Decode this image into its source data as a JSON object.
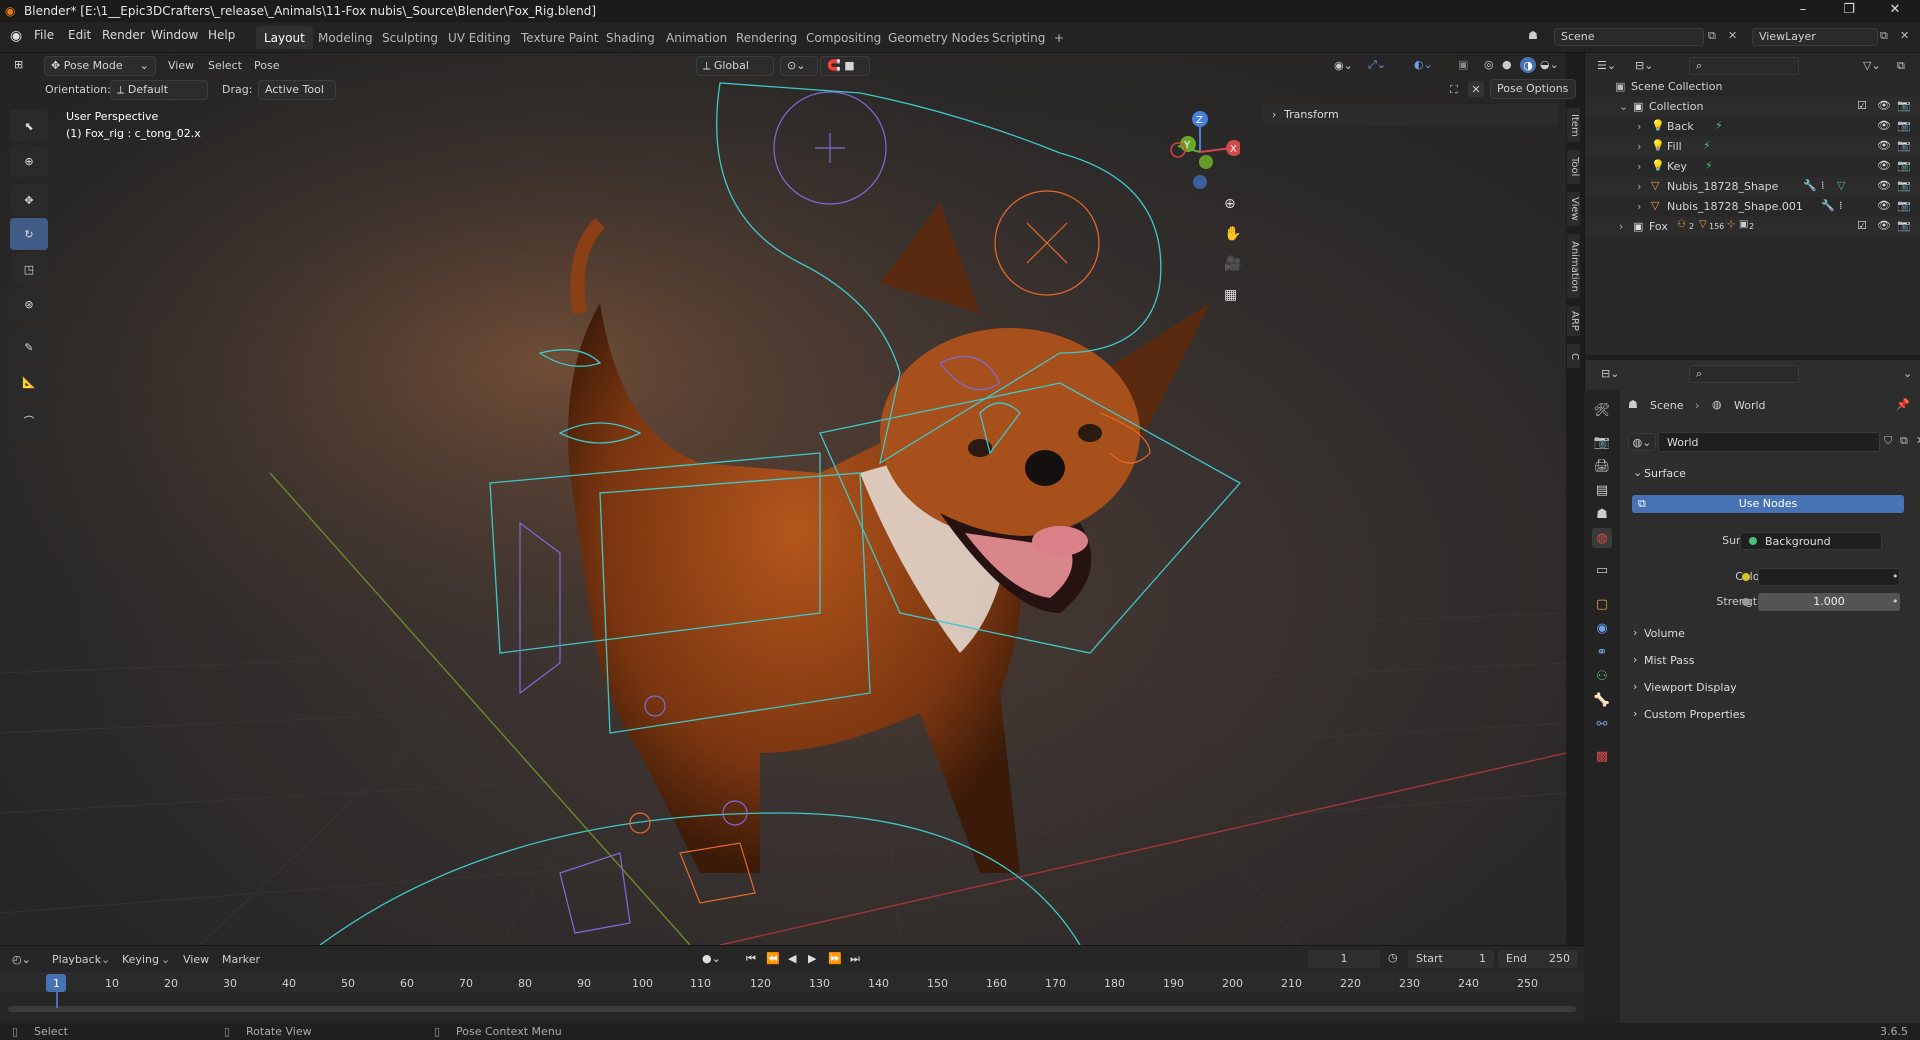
{
  "window": {
    "title": "Blender* [E:\\1__Epic3DCrafters\\_release\\_Animals\\11-Fox nubis\\_Source\\Blender\\Fox_Rig.blend]"
  },
  "menu": [
    "File",
    "Edit",
    "Render",
    "Window",
    "Help"
  ],
  "workspaces": [
    "Layout",
    "Modeling",
    "Sculpting",
    "UV Editing",
    "Texture Paint",
    "Shading",
    "Animation",
    "Rendering",
    "Compositing",
    "Geometry Nodes",
    "Scripting"
  ],
  "active_workspace": "Layout",
  "scene_field": "Scene",
  "viewlayer_field": "ViewLayer",
  "viewport": {
    "mode": "Pose Mode",
    "menus": [
      "View",
      "Select",
      "Pose"
    ],
    "transform_space": "Global",
    "orientation_label": "Orientation:",
    "orientation_value": "Default",
    "drag_label": "Drag:",
    "drag_value": "Active Tool",
    "pose_options": "Pose Options",
    "overlay_line1": "User Perspective",
    "overlay_line2": "(1) Fox_rig : c_tong_02.x",
    "npanel_section": "Transform",
    "npanel_tabs": [
      "Item",
      "Tool",
      "View",
      "Animation",
      "ARP",
      "C"
    ],
    "gizmo_axes": [
      "X",
      "Y",
      "Z"
    ]
  },
  "outliner": {
    "root": "Scene Collection",
    "items": [
      {
        "name": "Collection",
        "depth": 1
      },
      {
        "name": "Back",
        "depth": 2
      },
      {
        "name": "Fill",
        "depth": 2
      },
      {
        "name": "Key",
        "depth": 2
      },
      {
        "name": "Nubis_18728_Shape",
        "depth": 2
      },
      {
        "name": "Nubis_18728_Shape.001",
        "depth": 2
      },
      {
        "name": "Fox",
        "depth": 1
      }
    ],
    "fox_badges": [
      "2",
      "156",
      "2"
    ]
  },
  "properties": {
    "breadcrumb": [
      "Scene",
      "World"
    ],
    "datablock": "World",
    "surface_panel": "Surface",
    "use_nodes": "Use Nodes",
    "surface_label": "Surface",
    "surface_value": "Background",
    "color_label": "Color",
    "strength_label": "Strength",
    "strength_value": "1.000",
    "collapsed_panels": [
      "Volume",
      "Mist Pass",
      "Viewport Display",
      "Custom Properties"
    ]
  },
  "timeline": {
    "menus": [
      "Playback",
      "Keying",
      "View",
      "Marker"
    ],
    "current_frame": "1",
    "start_label": "Start",
    "start_value": "1",
    "end_label": "End",
    "end_value": "250",
    "ticks": [
      "1",
      "10",
      "20",
      "30",
      "40",
      "50",
      "60",
      "70",
      "80",
      "90",
      "100",
      "110",
      "120",
      "130",
      "140",
      "150",
      "160",
      "170",
      "180",
      "190",
      "200",
      "210",
      "220",
      "230",
      "240",
      "250"
    ]
  },
  "statusbar": {
    "select": "Select",
    "rotate": "Rotate View",
    "context": "Pose Context Menu",
    "version": "3.6.5"
  },
  "colors": {
    "accent": "#4772b3",
    "rig_cyan": "#3fc7c7",
    "rig_orange": "#e8692a",
    "rig_purple": "#7d6cd6"
  }
}
